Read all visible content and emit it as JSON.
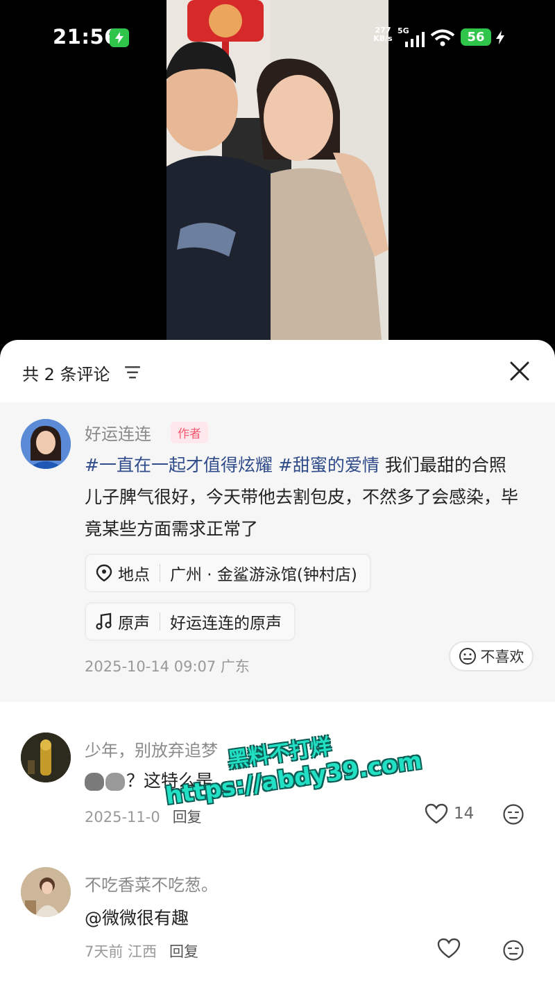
{
  "status_bar": {
    "time": "21:56",
    "net_speed": "277",
    "net_unit": "KB/s",
    "network_gen": "5G",
    "battery": "56",
    "accent_color": "#2fc44a"
  },
  "sheet": {
    "title": "共 2 条评论",
    "sort_icon": "sort-icon",
    "close_icon": "close-icon"
  },
  "author_post": {
    "name": "好运连连",
    "tag": "作者",
    "hashtag_1": "#一直在一起才值得炫耀",
    "hashtag_2": "#甜蜜的爱情",
    "text": "我们最甜的合照 儿子脾气很好，今天带他去割包皮，不然多了会感染，毕竟某些方面需求正常了",
    "location_label": "地点",
    "location_value": "广州 · 金鲨游泳馆(钟村店)",
    "sound_label": "原声",
    "sound_value": "好运连连的原声",
    "timestamp": "2025-10-14 09:07 广东",
    "dislike_label": "不喜欢"
  },
  "comments": [
    {
      "name": "少年，别放弃追梦",
      "text": "？这特么是",
      "date": "2025-11-0",
      "reply_label": "回复",
      "likes": "14"
    },
    {
      "name": "不吃香菜不吃葱。",
      "text": "@微微很有趣",
      "date": "7天前 江西",
      "reply_label": "回复",
      "likes": ""
    }
  ],
  "watermark": {
    "line1": "黑料不打烊",
    "line2": "https://abdy39.com"
  }
}
